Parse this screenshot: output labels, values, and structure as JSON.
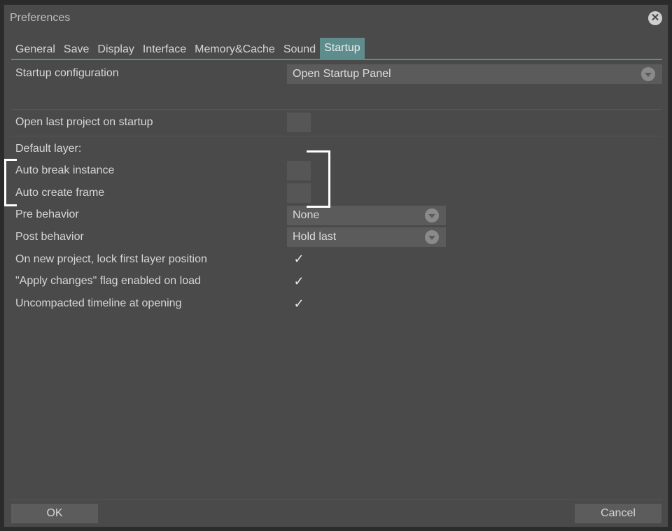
{
  "dialog": {
    "title": "Preferences",
    "close_icon": "close-icon"
  },
  "tabs": [
    {
      "label": "General",
      "active": false
    },
    {
      "label": "Save",
      "active": false
    },
    {
      "label": "Display",
      "active": false
    },
    {
      "label": "Interface",
      "active": false
    },
    {
      "label": "Memory&Cache",
      "active": false
    },
    {
      "label": "Sound",
      "active": false
    },
    {
      "label": "Startup",
      "active": true
    }
  ],
  "settings": {
    "startup_configuration": {
      "label": "Startup configuration",
      "value": "Open Startup Panel"
    },
    "open_last_project": {
      "label": "Open last project on startup",
      "checked": false
    },
    "default_layer": {
      "label": "Default layer:"
    },
    "auto_break_instance": {
      "label": "Auto break instance",
      "checked": false
    },
    "auto_create_frame": {
      "label": "Auto create frame",
      "checked": false
    },
    "pre_behavior": {
      "label": "Pre behavior",
      "value": "None"
    },
    "post_behavior": {
      "label": "Post behavior",
      "value": "Hold last"
    },
    "lock_first_layer": {
      "label": "On new project, lock first layer position",
      "checked": true,
      "mark": "✓"
    },
    "apply_changes_flag": {
      "label": "\"Apply changes\" flag enabled on load",
      "checked": true,
      "mark": "✓"
    },
    "uncompacted_timeline": {
      "label": "Uncompacted timeline at opening",
      "checked": true,
      "mark": "✓"
    }
  },
  "buttons": {
    "ok": "OK",
    "cancel": "Cancel"
  },
  "colors": {
    "active_tab": "#5f8c8c",
    "panel": "#4a4a4a",
    "annotation": "#ffffff"
  }
}
